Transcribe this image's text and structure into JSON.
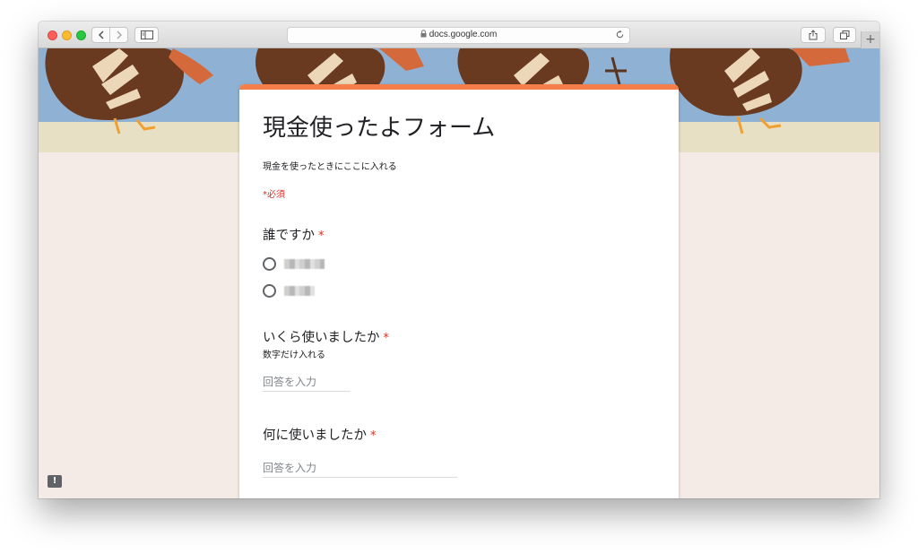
{
  "browser": {
    "url": "docs.google.com"
  },
  "form": {
    "title": "現金使ったよフォーム",
    "description": "現金を使ったときにここに入れる",
    "required_note": "*必須",
    "accent_color": "#f57e4a",
    "questions": [
      {
        "title": "誰ですか",
        "required_mark": "*",
        "options": [
          "■■■■",
          "■■■"
        ]
      },
      {
        "title": "いくら使いましたか",
        "required_mark": "*",
        "help": "数字だけ入れる",
        "placeholder": "回答を入力"
      },
      {
        "title": "何に使いましたか",
        "required_mark": "*",
        "placeholder": "回答を入力"
      }
    ]
  },
  "feedback": {
    "label": "!"
  },
  "colors": {
    "background": "#f5ebe6",
    "required": "#d93025",
    "banner_sky": "#8fb1d3"
  }
}
